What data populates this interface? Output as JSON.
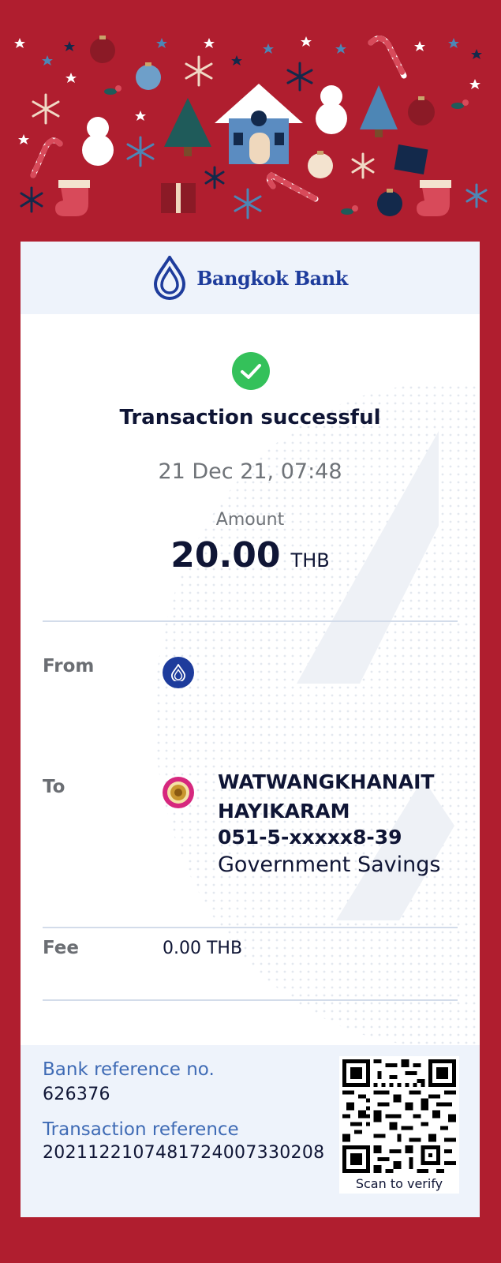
{
  "brand": {
    "name": "Bangkok Bank",
    "color": "#1e3c9c"
  },
  "status": {
    "title": "Transaction successful",
    "icon": "check-circle-icon",
    "color": "#34c15a"
  },
  "transaction": {
    "datetime": "21 Dec 21, 07:48",
    "amount_label": "Amount",
    "amount": "20.00",
    "currency": "THB"
  },
  "from": {
    "label": "From",
    "icon": "bangkok-bank-logo-icon"
  },
  "to": {
    "label": "To",
    "icon": "government-savings-bank-logo-icon",
    "name": "WATWANGKHANAIT HAYIKARAM",
    "account": "051-5-xxxxx8-39",
    "bank": "Government Savings"
  },
  "fee": {
    "label": "Fee",
    "value": "0.00 THB"
  },
  "references": {
    "bank_ref_label": "Bank reference no.",
    "bank_ref_value": "626376",
    "txn_ref_label": "Transaction reference",
    "txn_ref_value": "2021122107481724007330208"
  },
  "qr": {
    "caption": "Scan to verify"
  },
  "theme": {
    "background": "#b01e2f",
    "accent_blue": "#3f6bb5",
    "text_dark": "#0f1535"
  }
}
